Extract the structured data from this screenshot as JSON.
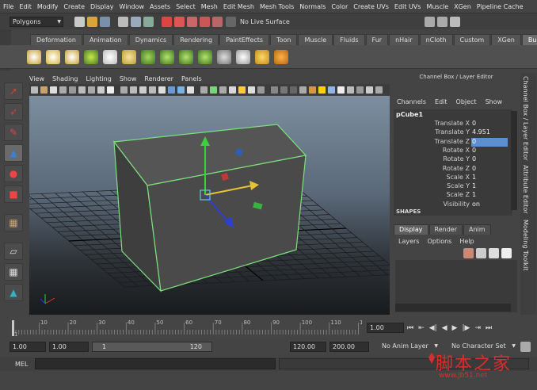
{
  "menubar": [
    "File",
    "Edit",
    "Modify",
    "Create",
    "Display",
    "Window",
    "Assets",
    "Select",
    "Mesh",
    "Edit Mesh",
    "Mesh Tools",
    "Normals",
    "Color",
    "Create UVs",
    "Edit UVs",
    "Muscle",
    "XGen",
    "Pipeline Cache"
  ],
  "status": {
    "mode": "Polygons",
    "live_surface": "No Live Surface"
  },
  "shelf_tabs": [
    "Deformation",
    "Animation",
    "Dynamics",
    "Rendering",
    "PaintEffects",
    "Toon",
    "Muscle",
    "Fluids",
    "Fur",
    "nHair",
    "nCloth",
    "Custom",
    "XGen",
    "Bullet"
  ],
  "shelf_active_tab": "Bullet",
  "panel_menu": [
    "View",
    "Shading",
    "Lighting",
    "Show",
    "Renderer",
    "Panels"
  ],
  "channel_box": {
    "header": "Channel Box / Layer Editor",
    "menu": [
      "Channels",
      "Edit",
      "Object",
      "Show"
    ],
    "object": "pCube1",
    "attrs": [
      {
        "label": "Translate X",
        "value": "0"
      },
      {
        "label": "Translate Y",
        "value": "4.951"
      },
      {
        "label": "Translate Z",
        "value": "0"
      },
      {
        "label": "Rotate X",
        "value": "0"
      },
      {
        "label": "Rotate Y",
        "value": "0"
      },
      {
        "label": "Rotate Z",
        "value": "0"
      },
      {
        "label": "Scale X",
        "value": "1"
      },
      {
        "label": "Scale Y",
        "value": "1"
      },
      {
        "label": "Scale Z",
        "value": "1"
      },
      {
        "label": "Visibility",
        "value": "on"
      }
    ],
    "shapes": "SHAPES",
    "selected_attr": "Translate Z"
  },
  "layer_editor": {
    "tabs": [
      "Display",
      "Render",
      "Anim"
    ],
    "active_tab": "Display",
    "menu": [
      "Layers",
      "Options",
      "Help"
    ]
  },
  "vertical_tabs": [
    "Channel Box / Layer Editor",
    "Attribute Editor",
    "Modeling Toolkit"
  ],
  "timeline": {
    "ticks": [
      "1",
      "10",
      "20",
      "30",
      "40",
      "50",
      "60",
      "70",
      "80",
      "90",
      "100",
      "110",
      "120"
    ],
    "current_frame": "1.00"
  },
  "range": {
    "start": "1.00",
    "playback_start": "1.00",
    "slider_start": "1",
    "slider_end": "120",
    "playback_end": "120.00",
    "end": "200.00",
    "anim_layer": "No Anim Layer",
    "character_set": "No Character Set"
  },
  "cmd": {
    "label": "MEL"
  },
  "watermark": {
    "cn": "脚本之家",
    "url": "www.jb51.net"
  },
  "colors": {
    "bg": "#444444",
    "field": "#2f2f2f",
    "highlight": "#5d8fd0",
    "selection_green": "#7de07d"
  }
}
